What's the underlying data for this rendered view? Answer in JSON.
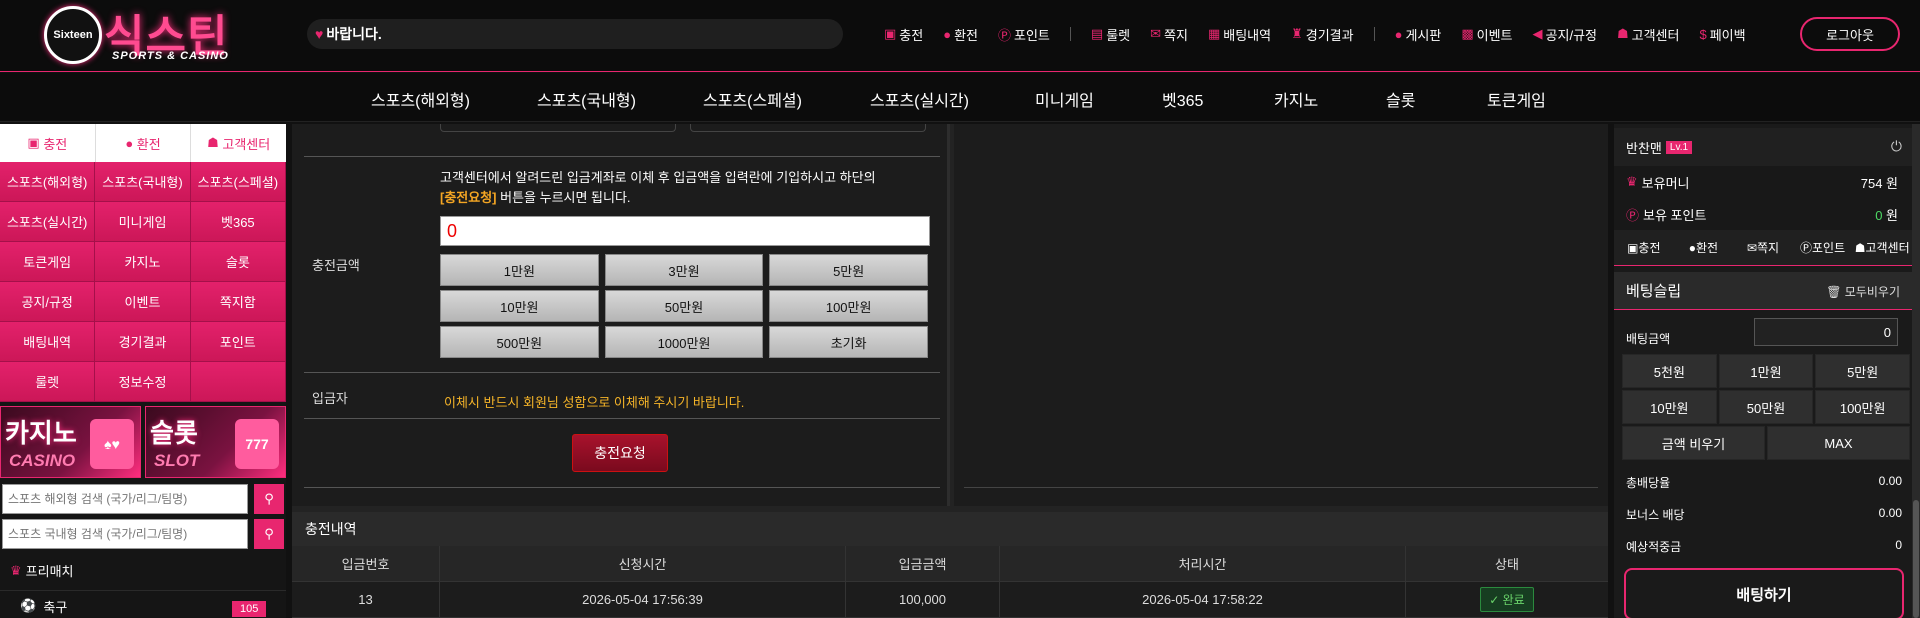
{
  "header": {
    "logo_circle_text": "Sixteen",
    "logo_main": "식스틴",
    "logo_sub": "SPORTS & CASINO",
    "notice": "바랍니다.",
    "nav": [
      {
        "label": "충전",
        "icon": "charge-icon"
      },
      {
        "label": "환전",
        "icon": "exchange-icon"
      },
      {
        "label": "포인트",
        "icon": "point-icon"
      },
      {
        "label": "룰렛",
        "icon": "roulette-icon"
      },
      {
        "label": "쪽지",
        "icon": "mail-icon"
      },
      {
        "label": "배팅내역",
        "icon": "history-icon"
      },
      {
        "label": "경기결과",
        "icon": "trophy-icon"
      },
      {
        "label": "게시판",
        "icon": "board-icon"
      },
      {
        "label": "이벤트",
        "icon": "gift-icon"
      },
      {
        "label": "공지/규정",
        "icon": "megaphone-icon"
      },
      {
        "label": "고객센터",
        "icon": "support-icon"
      },
      {
        "label": "페이백",
        "icon": "payback-icon"
      }
    ],
    "logout": "로그아웃"
  },
  "mainnav": [
    "스포츠(해외형)",
    "스포츠(국내형)",
    "스포츠(스페셜)",
    "스포츠(실시간)",
    "미니게임",
    "벳365",
    "카지노",
    "슬롯",
    "토큰게임"
  ],
  "sidebar": {
    "tabs": [
      "충전",
      "환전",
      "고객센터"
    ],
    "grid": [
      "스포츠(해외형)",
      "스포츠(국내형)",
      "스포츠(스페셜)",
      "스포츠(실시간)",
      "미니게임",
      "벳365",
      "토큰게임",
      "카지노",
      "슬롯",
      "공지/규정",
      "이벤트",
      "쪽지함",
      "배팅내역",
      "경기결과",
      "포인트",
      "룰렛",
      "정보수정",
      ""
    ],
    "banner_casino": {
      "title": "카지노",
      "sub": "CASINO"
    },
    "banner_slot": {
      "title": "슬롯",
      "sub": "SLOT",
      "badge": "777"
    },
    "search1_placeholder": "스포츠 해외형 검색 (국가/리그/팀명)",
    "search2_placeholder": "스포츠 국내형 검색 (국가/리그/팀명)",
    "prematch": "프리매치",
    "sport_item": {
      "label": "축구",
      "count": "105"
    }
  },
  "form": {
    "amount_label": "충전금액",
    "info_line1": "고객센터에서 알려드린 입금계좌로 이체 후 입금액을 입력란에 기입하시고 하단의",
    "info_highlight": "[충전요청]",
    "info_line2": " 버튼을 누르시면 됩니다.",
    "amount_value": "0",
    "quick_buttons": [
      "1만원",
      "3만원",
      "5만원",
      "10만원",
      "50만원",
      "100만원",
      "500만원",
      "1000만원",
      "초기화"
    ],
    "depositor_label": "입금자",
    "depositor_note": "이체시 반드시 회원님 성함으로 이체해 주시기 바랍니다.",
    "request_button": "충전요청"
  },
  "history": {
    "title": "충전내역",
    "columns": [
      "입금번호",
      "신청시간",
      "입금금액",
      "처리시간",
      "상태"
    ],
    "rows": [
      {
        "no": "13",
        "requested": "2026-05-04 17:56:39",
        "amount": "100,000",
        "processed": "2026-05-04 17:58:22",
        "status": "완료"
      }
    ]
  },
  "right": {
    "username": "반찬맨",
    "level": "Lv.1",
    "money_label": "보유머니",
    "money_value": "754 원",
    "point_label": "보유 포인트",
    "point_value": "0",
    "point_unit": " 원",
    "menu": [
      "충전",
      "환전",
      "쪽지",
      "포인트",
      "고객센터"
    ],
    "slip_title": "베팅슬립",
    "clear_all": "모두비우기",
    "bet_amount_label": "배팅금액",
    "bet_amount_value": "0",
    "bet_buttons": [
      "5천원",
      "1만원",
      "5만원",
      "10만원",
      "50만원",
      "100만원"
    ],
    "clear_amount": "금액 비우기",
    "max": "MAX",
    "total_odds_label": "총배당율",
    "total_odds_value": "0.00",
    "bonus_label": "보너스 배당",
    "bonus_value": "0.00",
    "expected_label": "예상적중금",
    "expected_value": "0",
    "bet_button": "배팅하기"
  },
  "colors": {
    "accent": "#e8266f",
    "status_ok": "#6ad36a",
    "highlight": "#f5a623"
  }
}
